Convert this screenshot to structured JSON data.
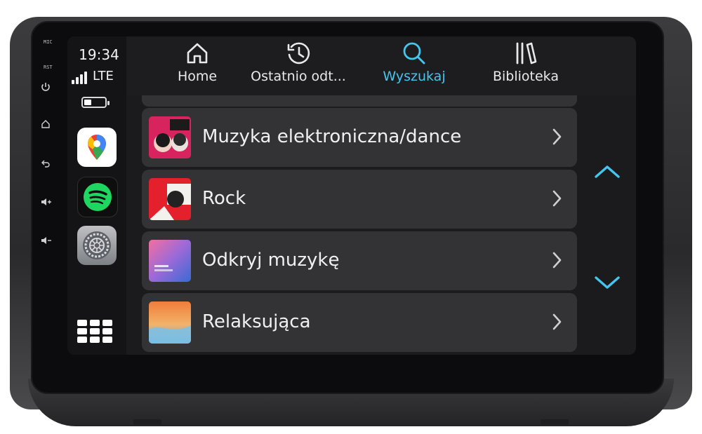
{
  "hardware": {
    "mic_label": "MIC",
    "rst_label": "RST"
  },
  "status": {
    "time": "19:34",
    "network": "LTE",
    "signal_bars": 4,
    "battery_level": 0.35
  },
  "dock": {
    "apps": [
      "maps-app-icon",
      "spotify-app-icon",
      "settings-app-icon"
    ],
    "launcher": "app-grid-icon"
  },
  "nav": {
    "tabs": [
      {
        "label": "Home",
        "icon": "home-icon",
        "active": false
      },
      {
        "label": "Ostatnio odt...",
        "icon": "recent-clock-icon",
        "active": false
      },
      {
        "label": "Wyszukaj",
        "icon": "search-icon",
        "active": true
      },
      {
        "label": "Biblioteka",
        "icon": "library-icon",
        "active": false
      }
    ],
    "now_playing_icon": "waveform-icon",
    "accent_color": "#45c6ee"
  },
  "list": {
    "items": [
      {
        "title": "Muzyka elektroniczna/dance",
        "art": "electronic-art"
      },
      {
        "title": "Rock",
        "art": "rock-art"
      },
      {
        "title": "Odkryj muzykę",
        "art": "discover-art"
      },
      {
        "title": "Relaksująca",
        "art": "relax-art"
      }
    ]
  },
  "scroll": {
    "up_icon": "chevron-up-icon",
    "down_icon": "chevron-down-icon"
  }
}
